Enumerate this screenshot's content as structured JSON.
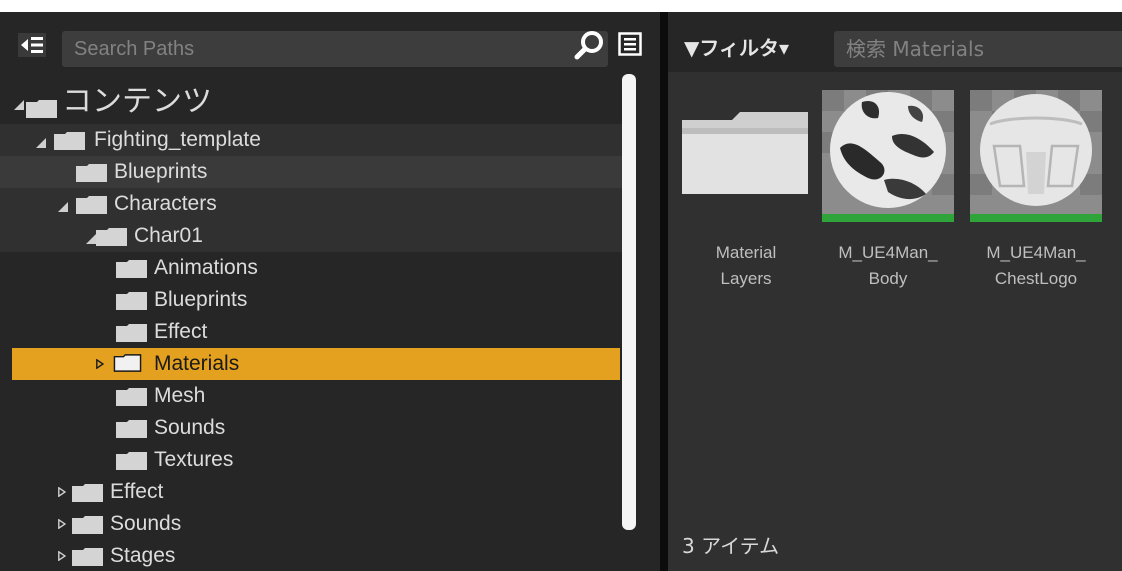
{
  "left_panel": {
    "search_placeholder": "Search Paths",
    "tree": [
      {
        "label": "コンテンツ",
        "expanded": true
      },
      {
        "label": "Fighting_template",
        "expanded": true
      },
      {
        "label": "Blueprints"
      },
      {
        "label": "Characters",
        "expanded": true
      },
      {
        "label": "Char01",
        "expanded": true
      },
      {
        "label": "Animations"
      },
      {
        "label": "Blueprints"
      },
      {
        "label": "Effect"
      },
      {
        "label": "Materials",
        "selected": true,
        "expanded": false
      },
      {
        "label": "Mesh"
      },
      {
        "label": "Sounds"
      },
      {
        "label": "Textures"
      },
      {
        "label": "Effect",
        "expanded": false
      },
      {
        "label": "Sounds",
        "expanded": false
      },
      {
        "label": "Stages",
        "expanded": false
      }
    ]
  },
  "right_panel": {
    "filter_label": "▼フィルタ▾",
    "search_placeholder": "検索 Materials",
    "items": [
      {
        "line1": "Material",
        "line2": "Layers",
        "icon": "folder-icon"
      },
      {
        "line1": "M_UE4Man_",
        "line2": "Body",
        "icon": "material-thumbnail"
      },
      {
        "line1": "M_UE4Man_",
        "line2": "ChestLogo",
        "icon": "material-thumbnail"
      }
    ],
    "item_count": "3 アイテム"
  },
  "colors": {
    "selection": "#e3a11f",
    "panel": "#262626",
    "asset_bar": "#2ea43a"
  }
}
